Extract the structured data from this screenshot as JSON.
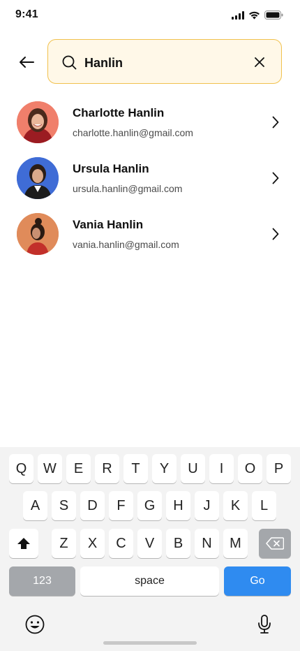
{
  "status_bar": {
    "time": "9:41"
  },
  "search": {
    "value": "Hanlin"
  },
  "results": [
    {
      "name": "Charlotte Hanlin",
      "email": "charlotte.hanlin@gmail.com",
      "avatar_bg": "#f07f6b"
    },
    {
      "name": "Ursula Hanlin",
      "email": "ursula.hanlin@gmail.com",
      "avatar_bg": "#3f6cd6"
    },
    {
      "name": "Vania Hanlin",
      "email": "vania.hanlin@gmail.com",
      "avatar_bg": "#e08b5a"
    }
  ],
  "keyboard": {
    "row1": [
      "Q",
      "W",
      "E",
      "R",
      "T",
      "Y",
      "U",
      "I",
      "O",
      "P"
    ],
    "row2": [
      "A",
      "S",
      "D",
      "F",
      "G",
      "H",
      "J",
      "K",
      "L"
    ],
    "row3": [
      "Z",
      "X",
      "C",
      "V",
      "B",
      "N",
      "M"
    ],
    "numbers_label": "123",
    "space_label": "space",
    "go_label": "Go"
  },
  "colors": {
    "search_border": "#f1c14d",
    "search_bg": "#fff8e8",
    "go_key": "#2f8bf0"
  },
  "icons": [
    "signal-icon",
    "wifi-icon",
    "battery-icon",
    "back-arrow-icon",
    "search-icon",
    "clear-icon",
    "chevron-right-icon",
    "shift-icon",
    "backspace-icon",
    "emoji-icon",
    "microphone-icon"
  ]
}
